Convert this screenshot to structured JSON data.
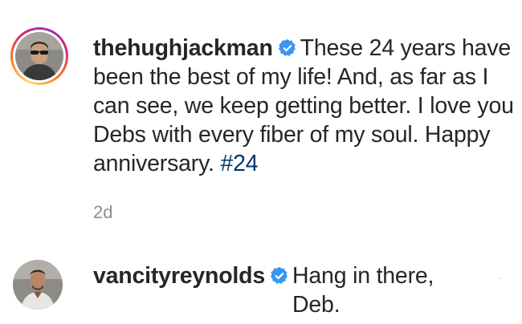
{
  "comments": [
    {
      "username": "thehughjackman",
      "verified": true,
      "text_before_tag": "These 24 years have been the best of my life! And, as far as I can see, we keep getting better. I love you Debs with every fiber of my soul. Happy anniversary.",
      "hashtag": "#24",
      "timestamp": "2d",
      "avatar_has_story_ring": true
    },
    {
      "username": "vancityreynolds",
      "verified": true,
      "text": "Hang in there, Deb."
    }
  ],
  "colors": {
    "text": "#262626",
    "hashtag": "#00376b",
    "timestamp": "#8e8e8e",
    "verified_badge": "#3897f0"
  },
  "icons": {
    "verified": "verified-badge-icon"
  }
}
